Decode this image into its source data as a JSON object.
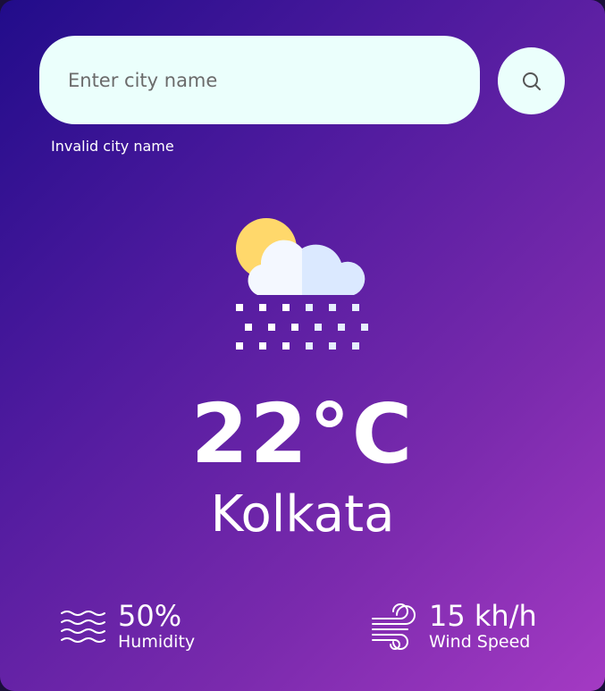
{
  "search": {
    "placeholder": "Enter city name",
    "value": "",
    "error": "Invalid city name",
    "button_icon": "search-icon"
  },
  "weather": {
    "icon": "snow-partly-cloudy-icon",
    "temperature": "22°C",
    "city": "Kolkata"
  },
  "details": {
    "humidity": {
      "icon": "humidity-waves-icon",
      "value": "50%",
      "label": "Humidity"
    },
    "wind": {
      "icon": "wind-icon",
      "value": "15 kh/h",
      "label": "Wind Speed"
    }
  },
  "colors": {
    "gradient_start": "#210c8a",
    "gradient_end": "#a43ac3",
    "input_bg": "#ebfffc",
    "text": "#ffffff"
  }
}
